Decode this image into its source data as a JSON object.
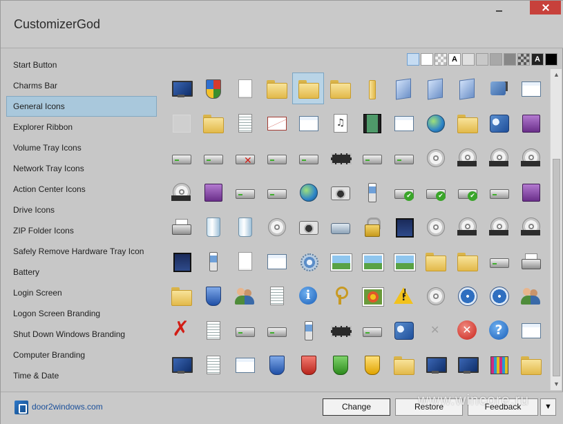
{
  "window": {
    "title": "CustomizerGod"
  },
  "sidebar": {
    "items": [
      {
        "label": "Start Button",
        "selected": false
      },
      {
        "label": "Charms Bar",
        "selected": false
      },
      {
        "label": "General Icons",
        "selected": true
      },
      {
        "label": "Explorer Ribbon",
        "selected": false
      },
      {
        "label": "Volume Tray Icons",
        "selected": false
      },
      {
        "label": "Network Tray Icons",
        "selected": false
      },
      {
        "label": "Action Center Icons",
        "selected": false
      },
      {
        "label": "Drive Icons",
        "selected": false
      },
      {
        "label": "ZIP Folder Icons",
        "selected": false
      },
      {
        "label": "Safely Remove Hardware Tray Icon",
        "selected": false
      },
      {
        "label": "Battery",
        "selected": false
      },
      {
        "label": "Login Screen",
        "selected": false
      },
      {
        "label": "Logon Screen Branding",
        "selected": false
      },
      {
        "label": "Shut Down Windows Branding",
        "selected": false
      },
      {
        "label": "Computer Branding",
        "selected": false
      },
      {
        "label": "Time & Date",
        "selected": false
      }
    ]
  },
  "background_swatches": [
    {
      "color": "#c6dcf2",
      "label": "",
      "selected": true
    },
    {
      "color": "#ffffff",
      "label": ""
    },
    {
      "color": "#f2f2f2",
      "label": "checker"
    },
    {
      "color": "#ffffff",
      "label": "A",
      "text_color": "#000000"
    },
    {
      "color": "#e0e0e0",
      "label": ""
    },
    {
      "color": "#c8c8c8",
      "label": ""
    },
    {
      "color": "#a8a8a8",
      "label": ""
    },
    {
      "color": "#888888",
      "label": ""
    },
    {
      "color": "#5a5a5a",
      "label": "checker"
    },
    {
      "color": "#222222",
      "label": "A",
      "text_color": "#ffffff"
    },
    {
      "color": "#000000",
      "label": ""
    }
  ],
  "icon_grid": {
    "selected_index": 4,
    "icons": [
      "monitor-icon",
      "uac-shield-icon",
      "blank-document-icon",
      "folder-open-icon",
      "folder-icon",
      "folder-icon",
      "folder-slim-icon",
      "search-folder-icon",
      "blue-folder-icon",
      "blue-folder-slim-icon",
      "puzzle-icon",
      "window-icon",
      "blank-icon",
      "folder-search-icon",
      "text-document-icon",
      "mail-icon",
      "picture-window-icon",
      "music-document-icon",
      "film-icon",
      "window-check-icon",
      "globe-network-icon",
      "folder-printer-icon",
      "control-panel-icon",
      "drive-purple-icon",
      "drive-icon",
      "drive-icon",
      "drive-error-icon",
      "drive-icon",
      "network-drive-icon",
      "memory-chip-icon",
      "drive-icon",
      "windows-drive-icon",
      "dvd-drive-icon",
      "dvd-r-icon",
      "dvd-ram-icon",
      "dvd-rom-icon",
      "dvd-rw-icon",
      "floppy-icon",
      "drive-icon",
      "zip-drive-icon",
      "globe-printer-icon",
      "camcorder-icon",
      "phone-icon",
      "drive-check-icon",
      "drive-check-icon",
      "drive-check-icon",
      "drive-icon",
      "drive-purple-icon",
      "printer-network-icon",
      "recycle-bin-icon",
      "recycle-bin-full-icon",
      "dvd-icon",
      "camera-icon",
      "mouse-icon",
      "lock-icon",
      "memory-card-icon",
      "disc-icon",
      "cd-r-icon",
      "cd-rom-icon",
      "cd-rw-icon",
      "pen-tablet-icon",
      "mobile-device-icon",
      "gear-document-icon",
      "gears-window-icon",
      "gears-icon",
      "picture-icon",
      "landscape-picture-icon",
      "landscape-picture-icon",
      "folder-globe-icon",
      "folder-network-icon",
      "drive-help-icon",
      "printer-icon",
      "font-folder-icon",
      "shield-blue-icon",
      "users-icon",
      "checklist-icon",
      "info-icon",
      "key-icon",
      "flower-picture-icon",
      "warning-icon",
      "media-disc-icon",
      "clock-icon",
      "programs-icon",
      "users-icon",
      "red-x-icon",
      "document-icon",
      "drive-network-icon",
      "scanner-icon",
      "pda-icon",
      "network-adapter-icon",
      "scanner-flat-icon",
      "blue-window-icon",
      "grey-x-icon",
      "error-icon",
      "help-icon",
      "picture-frame-icon",
      "screen-icon",
      "document-lines-icon",
      "presentation-icon",
      "shield-question-icon",
      "shield-error-icon",
      "shield-check-icon",
      "shield-warning-icon",
      "music-folder-icon",
      "computer-icon",
      "monitor-flat-icon",
      "mixer-icon",
      "folder-document-icon"
    ]
  },
  "scrollbar": {
    "up_arrow": "▲",
    "down_arrow": "▼"
  },
  "footer": {
    "brand_link": "door2windows.com",
    "buttons": {
      "change": "Change",
      "restore": "Restore",
      "feedback": "Feedback",
      "dropdown": "▼"
    },
    "watermark": "www.wincore.ru"
  },
  "colors": {
    "accent_selected": "#a9c8dc",
    "close_button": "#c7413b",
    "link": "#1a4f9a"
  }
}
